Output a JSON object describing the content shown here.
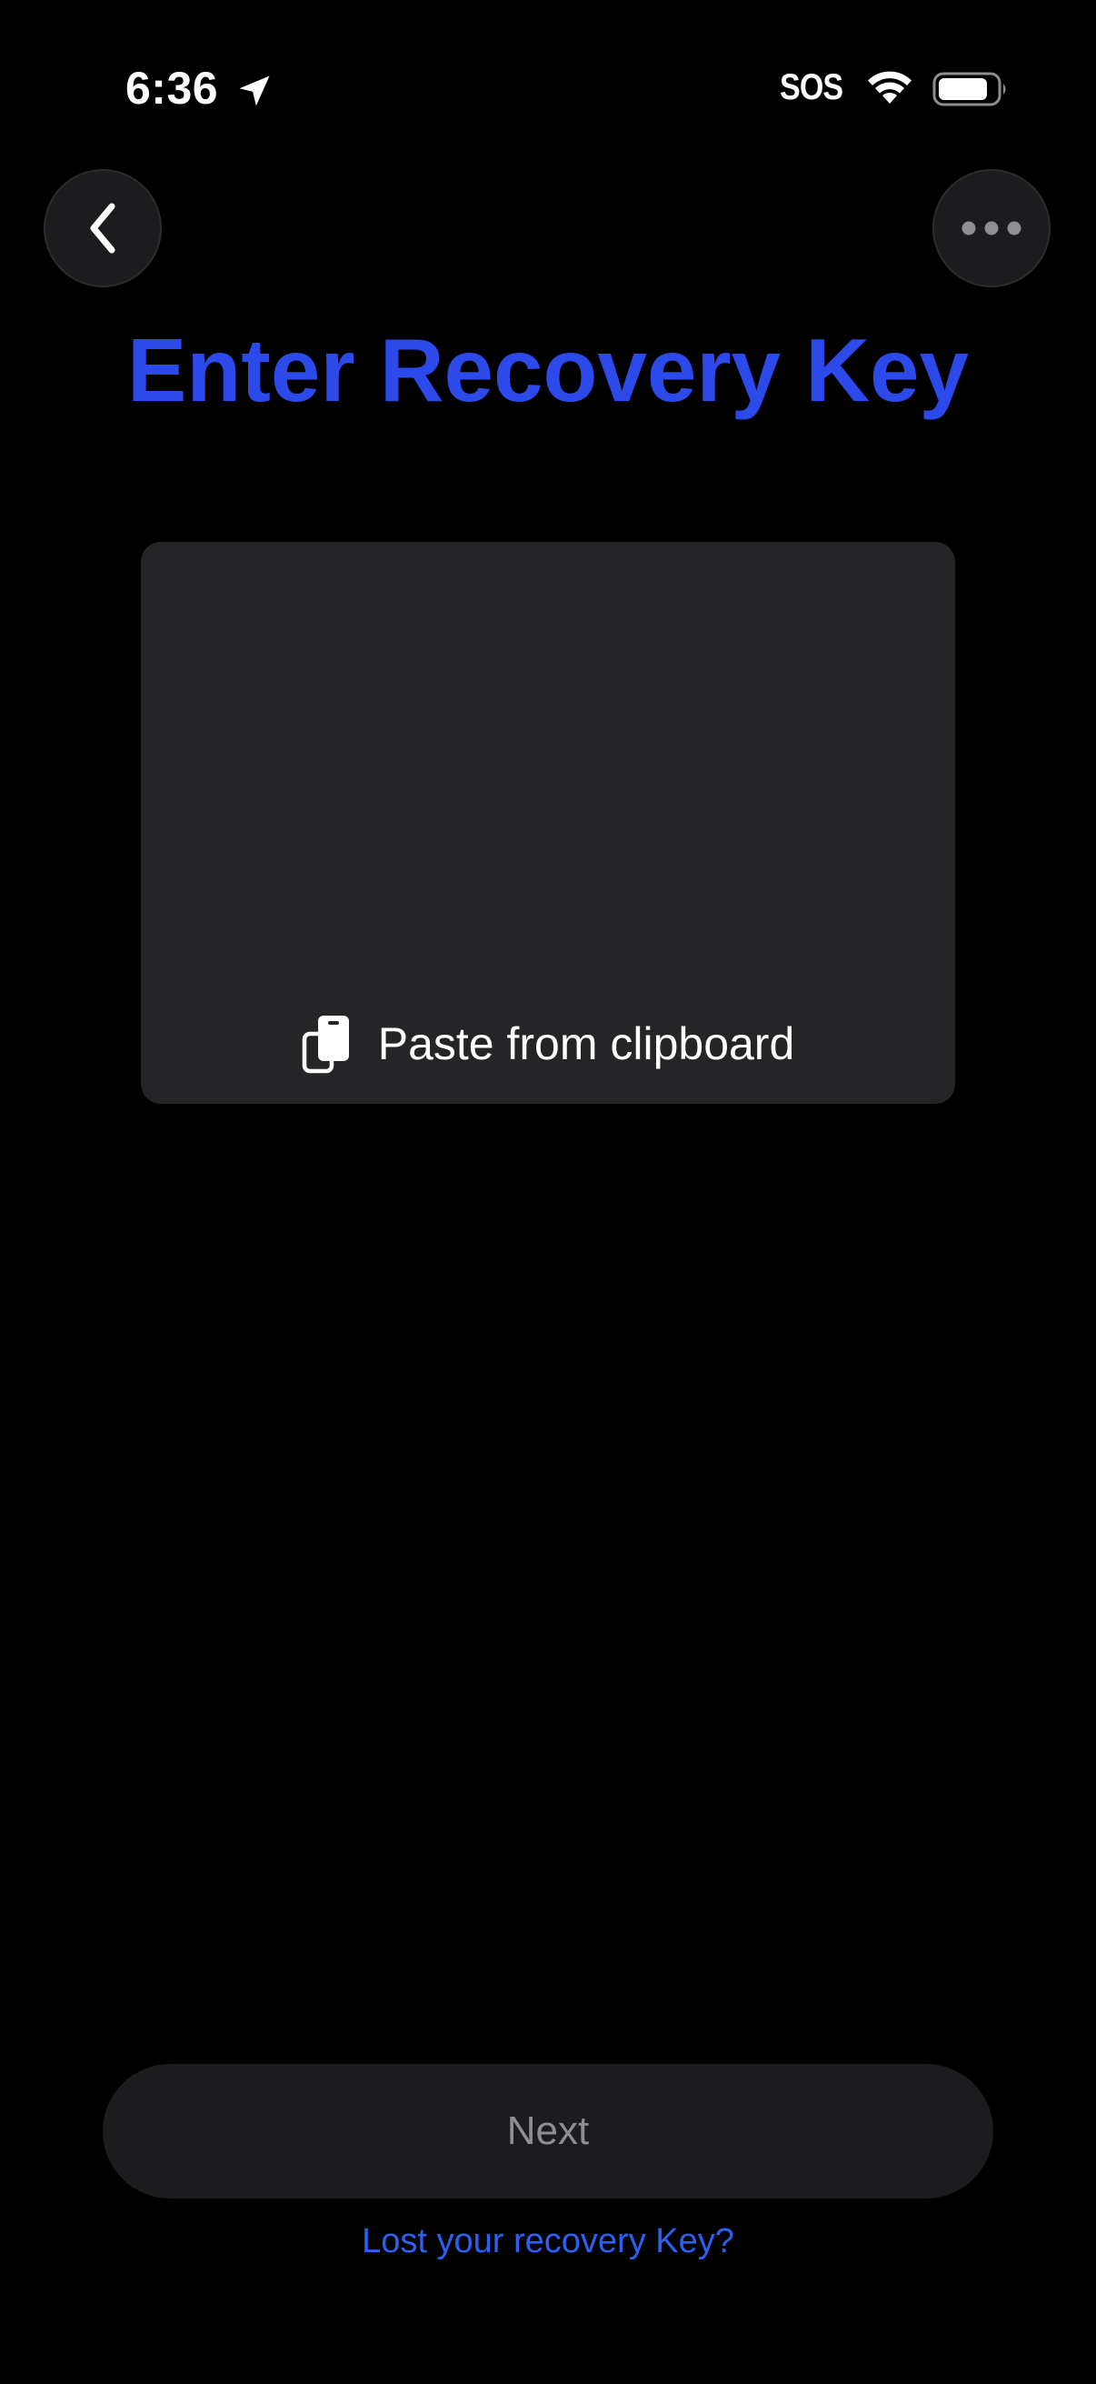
{
  "status_bar": {
    "time": "6:36",
    "carrier_status": "SOS",
    "battery_level": 0.85
  },
  "nav": {
    "back_icon": "chevron-left-icon",
    "more_icon": "ellipsis-icon"
  },
  "page": {
    "title": "Enter Recovery Key"
  },
  "key_input": {
    "value": "",
    "paste_icon": "clipboard-icon",
    "paste_label": "Paste from clipboard"
  },
  "actions": {
    "next_label": "Next",
    "lost_key_label": "Lost your recovery Key?"
  },
  "colors": {
    "accent": "#2c49ea",
    "link": "#2c60f0",
    "background": "#000000",
    "surface": "#252527",
    "button_disabled_text": "#8e8e93"
  }
}
